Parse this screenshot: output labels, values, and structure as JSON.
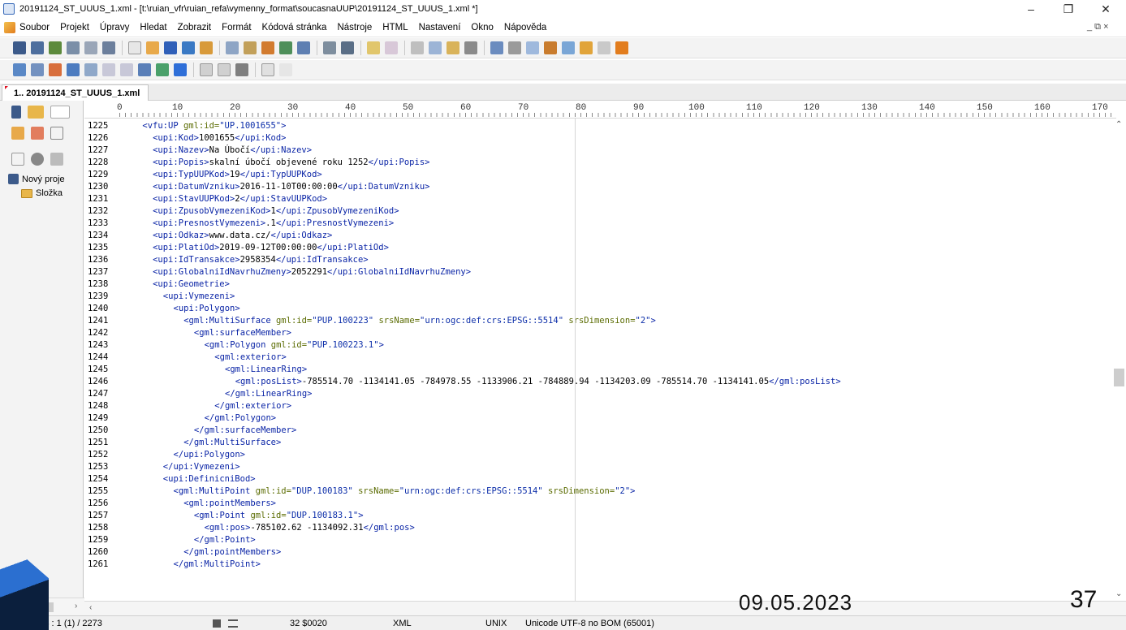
{
  "window": {
    "title": "20191124_ST_UUUS_1.xml - [t:\\ruian_vfr\\ruian_refa\\vymenny_format\\soucasnaUUP\\20191124_ST_UUUS_1.xml *]",
    "minimize": "–",
    "maximize": "❐",
    "close": "✕"
  },
  "menu": {
    "items": [
      "Soubor",
      "Projekt",
      "Úpravy",
      "Hledat",
      "Zobrazit",
      "Formát",
      "Kódová stránka",
      "Nástroje",
      "HTML",
      "Nastavení",
      "Okno",
      "Nápověda"
    ],
    "mdi_controls": "_ ⧉ ×"
  },
  "tab": {
    "label": "1.. 20191124_ST_UUUS_1.xml"
  },
  "sidebar": {
    "project": "Nový proje",
    "folder": "Složka"
  },
  "ruler": {
    "labels": [
      "0",
      "10",
      "20",
      "30",
      "40",
      "50",
      "60",
      "70",
      "80",
      "90",
      "100",
      "110",
      "120",
      "130",
      "140",
      "150",
      "160",
      "170"
    ]
  },
  "editor": {
    "line_numbers": [
      "1225",
      "1226",
      "1227",
      "1228",
      "1229",
      "1230",
      "1231",
      "1232",
      "1233",
      "1234",
      "1235",
      "1236",
      "1237",
      "1238",
      "1239",
      "1240",
      "1241",
      "1242",
      "1243",
      "1244",
      "1245",
      "1246",
      "1247",
      "1248",
      "1249",
      "1250",
      "1251",
      "1252",
      "1253",
      "1254",
      "1255",
      "1256",
      "1257",
      "1258",
      "1259",
      "1260",
      "1261"
    ],
    "lines": [
      {
        "indent": 4,
        "segments": [
          {
            "c": "t",
            "x": "<vfu:UP "
          },
          {
            "c": "a",
            "x": "gml:id="
          },
          {
            "c": "v",
            "x": "\"UP.1001655\""
          },
          {
            "c": "t",
            "x": ">"
          }
        ]
      },
      {
        "indent": 6,
        "segments": [
          {
            "c": "t",
            "x": "<upi:Kod>"
          },
          {
            "c": "",
            "x": "1001655"
          },
          {
            "c": "t",
            "x": "</upi:Kod>"
          }
        ]
      },
      {
        "indent": 6,
        "segments": [
          {
            "c": "t",
            "x": "<upi:Nazev>"
          },
          {
            "c": "",
            "x": "Na Úbočí"
          },
          {
            "c": "t",
            "x": "</upi:Nazev>"
          }
        ]
      },
      {
        "indent": 6,
        "segments": [
          {
            "c": "t",
            "x": "<upi:Popis>"
          },
          {
            "c": "",
            "x": "skalní úbočí objevené roku 1252"
          },
          {
            "c": "t",
            "x": "</upi:Popis>"
          }
        ]
      },
      {
        "indent": 6,
        "segments": [
          {
            "c": "t",
            "x": "<upi:TypUUPKod>"
          },
          {
            "c": "",
            "x": "19"
          },
          {
            "c": "t",
            "x": "</upi:TypUUPKod>"
          }
        ]
      },
      {
        "indent": 6,
        "segments": [
          {
            "c": "t",
            "x": "<upi:DatumVzniku>"
          },
          {
            "c": "",
            "x": "2016-11-10T00:00:00"
          },
          {
            "c": "t",
            "x": "</upi:DatumVzniku>"
          }
        ]
      },
      {
        "indent": 6,
        "segments": [
          {
            "c": "t",
            "x": "<upi:StavUUPKod>"
          },
          {
            "c": "",
            "x": "2"
          },
          {
            "c": "t",
            "x": "</upi:StavUUPKod>"
          }
        ]
      },
      {
        "indent": 6,
        "segments": [
          {
            "c": "t",
            "x": "<upi:ZpusobVymezeniKod>"
          },
          {
            "c": "",
            "x": "1"
          },
          {
            "c": "t",
            "x": "</upi:ZpusobVymezeniKod>"
          }
        ]
      },
      {
        "indent": 6,
        "segments": [
          {
            "c": "t",
            "x": "<upi:PresnostVymezeni>"
          },
          {
            "c": "",
            "x": ".1"
          },
          {
            "c": "t",
            "x": "</upi:PresnostVymezeni>"
          }
        ]
      },
      {
        "indent": 6,
        "segments": [
          {
            "c": "t",
            "x": "<upi:Odkaz>"
          },
          {
            "c": "",
            "x": "www.data.cz/"
          },
          {
            "c": "t",
            "x": "</upi:Odkaz>"
          }
        ]
      },
      {
        "indent": 6,
        "segments": [
          {
            "c": "t",
            "x": "<upi:PlatiOd>"
          },
          {
            "c": "",
            "x": "2019-09-12T00:00:00"
          },
          {
            "c": "t",
            "x": "</upi:PlatiOd>"
          }
        ]
      },
      {
        "indent": 6,
        "segments": [
          {
            "c": "t",
            "x": "<upi:IdTransakce>"
          },
          {
            "c": "",
            "x": "2958354"
          },
          {
            "c": "t",
            "x": "</upi:IdTransakce>"
          }
        ]
      },
      {
        "indent": 6,
        "segments": [
          {
            "c": "t",
            "x": "<upi:GlobalniIdNavrhuZmeny>"
          },
          {
            "c": "",
            "x": "2052291"
          },
          {
            "c": "t",
            "x": "</upi:GlobalniIdNavrhuZmeny>"
          }
        ]
      },
      {
        "indent": 6,
        "segments": [
          {
            "c": "t",
            "x": "<upi:Geometrie>"
          }
        ]
      },
      {
        "indent": 8,
        "segments": [
          {
            "c": "t",
            "x": "<upi:Vymezeni>"
          }
        ]
      },
      {
        "indent": 10,
        "segments": [
          {
            "c": "t",
            "x": "<upi:Polygon>"
          }
        ]
      },
      {
        "indent": 12,
        "segments": [
          {
            "c": "t",
            "x": "<gml:MultiSurface "
          },
          {
            "c": "a",
            "x": "gml:id="
          },
          {
            "c": "v",
            "x": "\"PUP.100223\" "
          },
          {
            "c": "a",
            "x": "srsName="
          },
          {
            "c": "v",
            "x": "\"urn:ogc:def:crs:EPSG::5514\" "
          },
          {
            "c": "a",
            "x": "srsDimension="
          },
          {
            "c": "v",
            "x": "\"2\""
          },
          {
            "c": "t",
            "x": ">"
          }
        ]
      },
      {
        "indent": 14,
        "segments": [
          {
            "c": "t",
            "x": "<gml:surfaceMember>"
          }
        ]
      },
      {
        "indent": 16,
        "segments": [
          {
            "c": "t",
            "x": "<gml:Polygon "
          },
          {
            "c": "a",
            "x": "gml:id="
          },
          {
            "c": "v",
            "x": "\"PUP.100223.1\""
          },
          {
            "c": "t",
            "x": ">"
          }
        ]
      },
      {
        "indent": 18,
        "segments": [
          {
            "c": "t",
            "x": "<gml:exterior>"
          }
        ]
      },
      {
        "indent": 20,
        "segments": [
          {
            "c": "t",
            "x": "<gml:LinearRing>"
          }
        ]
      },
      {
        "indent": 22,
        "segments": [
          {
            "c": "t",
            "x": "<gml:posList>"
          },
          {
            "c": "",
            "x": "-785514.70 -1134141.05 -784978.55 -1133906.21 -784889.94 -1134203.09 -785514.70 -1134141.05"
          },
          {
            "c": "t",
            "x": "</gml:posList>"
          }
        ]
      },
      {
        "indent": 20,
        "segments": [
          {
            "c": "t",
            "x": "</gml:LinearRing>"
          }
        ]
      },
      {
        "indent": 18,
        "segments": [
          {
            "c": "t",
            "x": "</gml:exterior>"
          }
        ]
      },
      {
        "indent": 16,
        "segments": [
          {
            "c": "t",
            "x": "</gml:Polygon>"
          }
        ]
      },
      {
        "indent": 14,
        "segments": [
          {
            "c": "t",
            "x": "</gml:surfaceMember>"
          }
        ]
      },
      {
        "indent": 12,
        "segments": [
          {
            "c": "t",
            "x": "</gml:MultiSurface>"
          }
        ]
      },
      {
        "indent": 10,
        "segments": [
          {
            "c": "t",
            "x": "</upi:Polygon>"
          }
        ]
      },
      {
        "indent": 8,
        "segments": [
          {
            "c": "t",
            "x": "</upi:Vymezeni>"
          }
        ]
      },
      {
        "indent": 8,
        "segments": [
          {
            "c": "t",
            "x": "<upi:DefinicniBod>"
          }
        ]
      },
      {
        "indent": 10,
        "segments": [
          {
            "c": "t",
            "x": "<gml:MultiPoint "
          },
          {
            "c": "a",
            "x": "gml:id="
          },
          {
            "c": "v",
            "x": "\"DUP.100183\" "
          },
          {
            "c": "a",
            "x": "srsName="
          },
          {
            "c": "v",
            "x": "\"urn:ogc:def:crs:EPSG::5514\" "
          },
          {
            "c": "a",
            "x": "srsDimension="
          },
          {
            "c": "v",
            "x": "\"2\""
          },
          {
            "c": "t",
            "x": ">"
          }
        ]
      },
      {
        "indent": 12,
        "segments": [
          {
            "c": "t",
            "x": "<gml:pointMembers>"
          }
        ]
      },
      {
        "indent": 14,
        "segments": [
          {
            "c": "t",
            "x": "<gml:Point "
          },
          {
            "c": "a",
            "x": "gml:id="
          },
          {
            "c": "v",
            "x": "\"DUP.100183.1\""
          },
          {
            "c": "t",
            "x": ">"
          }
        ]
      },
      {
        "indent": 16,
        "segments": [
          {
            "c": "t",
            "x": "<gml:pos>"
          },
          {
            "c": "",
            "x": "-785102.62 -1134092.31"
          },
          {
            "c": "t",
            "x": "</gml:pos>"
          }
        ]
      },
      {
        "indent": 14,
        "segments": [
          {
            "c": "t",
            "x": "</gml:Point>"
          }
        ]
      },
      {
        "indent": 12,
        "segments": [
          {
            "c": "t",
            "x": "</gml:pointMembers>"
          }
        ]
      },
      {
        "indent": 10,
        "segments": [
          {
            "c": "t",
            "x": "</gml:MultiPoint>"
          }
        ]
      }
    ]
  },
  "status": {
    "position": "1224 : 1 (1) / 2273",
    "char": "32  $0020",
    "syntax": "XML",
    "eol": "UNIX",
    "encoding": "Unicode UTF-8 no BOM (65001)"
  },
  "slide": {
    "date": "09.05.2023",
    "page": "37"
  },
  "colors": {
    "tag": "#0a24a6",
    "attr": "#5a6b00",
    "value": "#0c2ea9"
  }
}
